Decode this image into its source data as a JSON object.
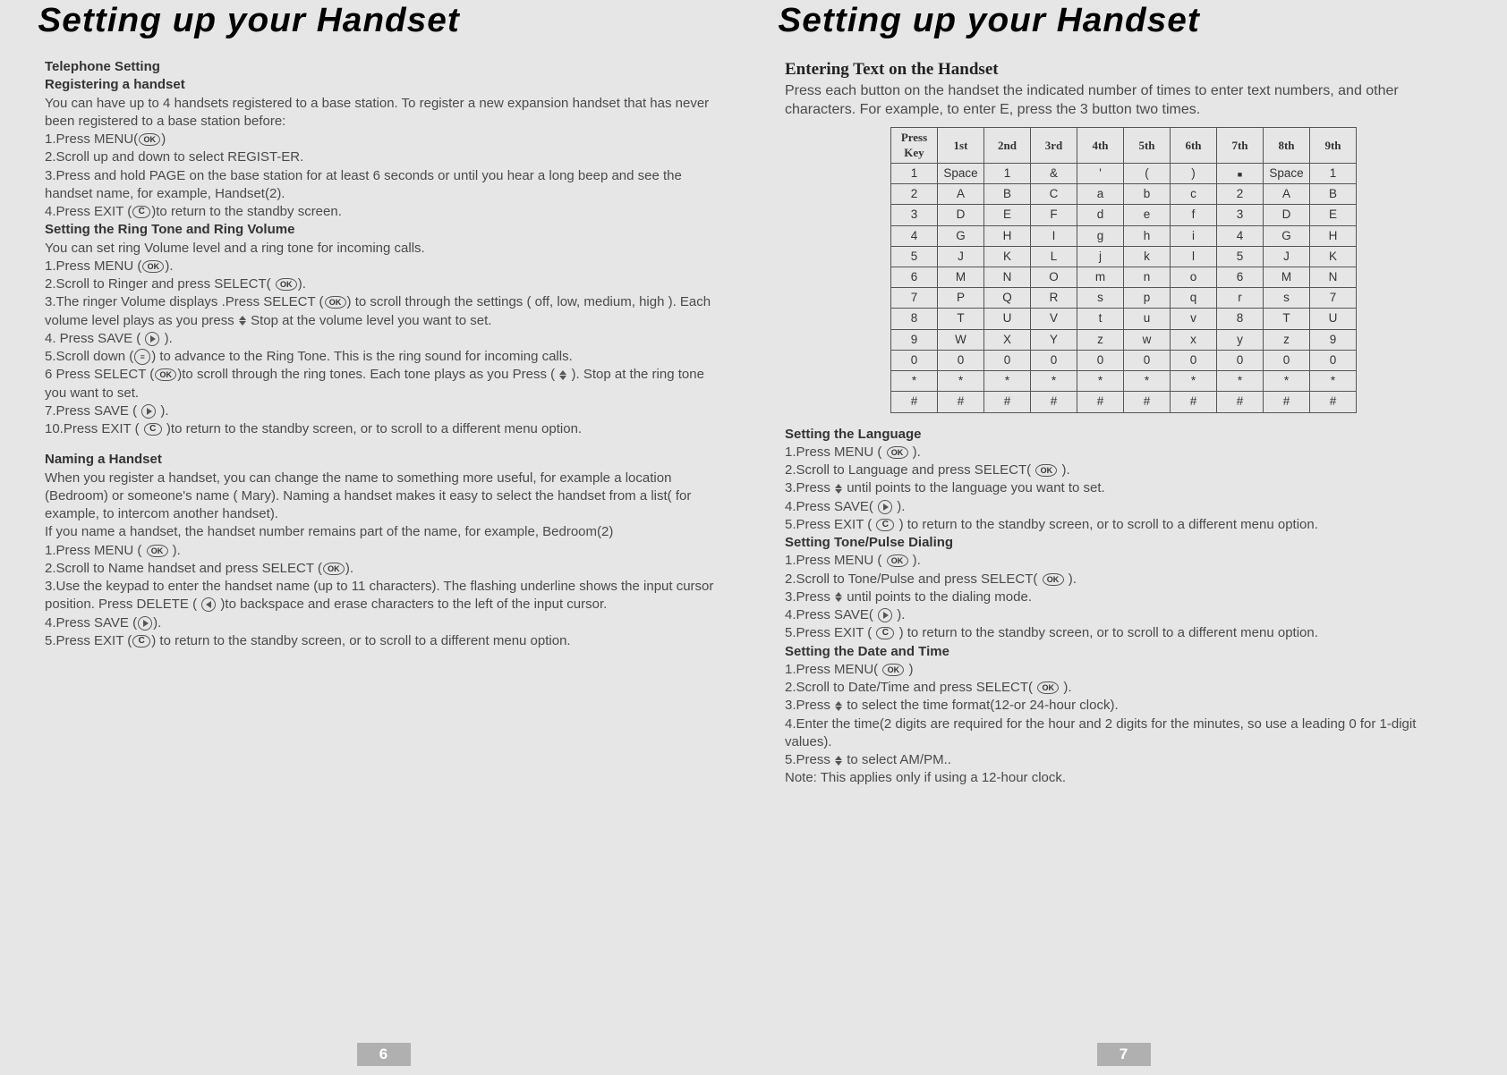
{
  "title_left": "Setting up your Handset",
  "title_right": "Setting up your Handset",
  "pagenum_left": "6",
  "pagenum_right": "7",
  "left": {
    "h_tel": "Telephone Setting",
    "h_reg": "Registering a handset",
    "reg_intro": "You can have up to 4 handsets registered to a base station. To register a new expansion handset that has never been registered to a base station before:",
    "reg_1a": "1.Press MENU(",
    "reg_1b": ")",
    "reg_2": "2.Scroll up and down to select REGIST-ER.",
    "reg_3": "3.Press and hold PAGE on the base station for at least 6 seconds or until you hear a long beep and see the handset name, for example, Handset(2).",
    "reg_4a": "4.Press EXIT (",
    "reg_4b": ")to return to the standby screen.",
    "h_ring": "Setting the Ring Tone and Ring Volume",
    "ring_intro": "You can set ring Volume level and  a ring tone for incoming calls.",
    "ring_1a": "1.Press MENU (",
    "ring_1b": ").",
    "ring_2a": "2.Scroll to Ringer and press SELECT( ",
    "ring_2b": ").",
    "ring_3a": "3.The ringer Volume displays .Press SELECT (",
    "ring_3b": ") to scroll through the settings  ( off, low, medium, high ). Each volume level plays as you press  ",
    "ring_3c": "  Stop at the volume level you want to set.",
    "ring_4a": "4. Press SAVE (  ",
    "ring_4b": "  ).",
    "ring_5a": "5.Scroll down (",
    "ring_5b": ") to advance to the Ring Tone. This is the ring sound for incoming calls.",
    "ring_6a": "6 Press SELECT (",
    "ring_6b": ")to scroll through the ring tones. Each tone plays as you Press ( ",
    "ring_6c": " ). Stop at the ring tone you want to set.",
    "ring_7a": "7.Press SAVE ( ",
    "ring_7b": " ).",
    "ring_10a": "10.Press EXIT ( ",
    "ring_10b": " )to return to the standby screen, or  to scroll to a different menu option.",
    "h_name": "Naming a Handset",
    "name_intro": " When you register a handset, you can change the name to something more useful, for example a location (Bedroom) or someone's name ( Mary). Naming a handset makes it easy to select the handset from a list( for example, to intercom another  handset).",
    "name_note": "If you name a handset, the handset number remains part of the name, for example, Bedroom(2)",
    "name_1a": "1.Press MENU ( ",
    "name_1b": " ).",
    "name_2a": "2.Scroll to Name handset and press SELECT (",
    "name_2b": ").",
    "name_3a": "3.Use the keypad to enter the handset name (up to 11 characters). The flashing underline shows the input cursor position. Press DELETE ( ",
    "name_3b": " )to backspace and erase characters to the left of the input cursor.",
    "name_4a": "4.Press SAVE (",
    "name_4b": ").",
    "name_5a": "5.Press EXIT (",
    "name_5b": ") to return to the standby screen, or  to scroll to a different menu option."
  },
  "right": {
    "h_entry": "Entering Text on the Handset",
    "entry_intro": "Press each button on the handset the indicated number of times to enter text numbers, and other characters. For example, to enter E, press the 3 button two times.",
    "h_lang": "Setting the Language",
    "lang_1a": "1.Press MENU ( ",
    "lang_1b": " ).",
    "lang_2a": "2.Scroll to Language and press SELECT( ",
    "lang_2b": " ).",
    "lang_3a": "3.Press ",
    "lang_3b": " until  points to the language you want to set.",
    "lang_4a": "4.Press SAVE(  ",
    "lang_4b": "  ).",
    "lang_5a": "5.Press EXIT (  ",
    "lang_5b": "  ) to return to the standby screen, or   to scroll to a different menu option.",
    "h_tone": "Setting Tone/Pulse Dialing",
    "tone_1a": "1.Press MENU ( ",
    "tone_1b": " ).",
    "tone_2a": "2.Scroll to Tone/Pulse  and press SELECT( ",
    "tone_2b": " ).",
    "tone_3a": "3.Press ",
    "tone_3b": " until  points to the dialing mode.",
    "tone_4a": "4.Press SAVE( ",
    "tone_4b": "  ).",
    "tone_5a": "5.Press EXIT ( ",
    "tone_5b": "   ) to return to the standby screen, or   to scroll to a different menu option.",
    "h_date": "Setting the Date and Time",
    "date_1a": "1.Press MENU( ",
    "date_1b": "  )",
    "date_2a": "2.Scroll to Date/Time and press SELECT(  ",
    "date_2b": "  ).",
    "date_3a": "3.Press  ",
    "date_3b": " to select the time format(12-or 24-hour clock).",
    "date_4": "4.Enter the time(2 digits are required for the hour and 2 digits for the minutes, so use a leading 0 for 1-digit values).",
    "date_5a": "5.Press  ",
    "date_5b": " to select AM/PM..",
    "date_note": " Note: This applies only if using a 12-hour clock."
  },
  "chart_data": {
    "type": "table",
    "title": "Text entry multi-tap table",
    "columns": [
      "Press Key",
      "1st",
      "2nd",
      "3rd",
      "4th",
      "5th",
      "6th",
      "7th",
      "8th",
      "9th"
    ],
    "rows": [
      [
        "1",
        "Space",
        "1",
        "&",
        "'",
        "(",
        ")",
        "■",
        "Space",
        "1"
      ],
      [
        "2",
        "A",
        "B",
        "C",
        "a",
        "b",
        "c",
        "2",
        "A",
        "B"
      ],
      [
        "3",
        "D",
        "E",
        "F",
        "d",
        "e",
        "f",
        "3",
        "D",
        "E"
      ],
      [
        "4",
        "G",
        "H",
        "I",
        "g",
        "h",
        "i",
        "4",
        "G",
        "H"
      ],
      [
        "5",
        "J",
        "K",
        "L",
        "j",
        "k",
        "l",
        "5",
        "J",
        "K"
      ],
      [
        "6",
        "M",
        "N",
        "O",
        "m",
        "n",
        "o",
        "6",
        "M",
        "N"
      ],
      [
        "7",
        "P",
        "Q",
        "R",
        "s",
        "p",
        "q",
        "r",
        "s",
        "7"
      ],
      [
        "8",
        "T",
        "U",
        "V",
        "t",
        "u",
        "v",
        "8",
        "T",
        "U"
      ],
      [
        "9",
        "W",
        "X",
        "Y",
        "z",
        "w",
        "x",
        "y",
        "z",
        "9"
      ],
      [
        "0",
        "0",
        "0",
        "0",
        "0",
        "0",
        "0",
        "0",
        "0",
        "0"
      ],
      [
        "*",
        "*",
        "*",
        "*",
        "*",
        "*",
        "*",
        "*",
        "*",
        "*"
      ],
      [
        "#",
        "#",
        "#",
        "#",
        "#",
        "#",
        "#",
        "#",
        "#",
        "#"
      ]
    ]
  }
}
